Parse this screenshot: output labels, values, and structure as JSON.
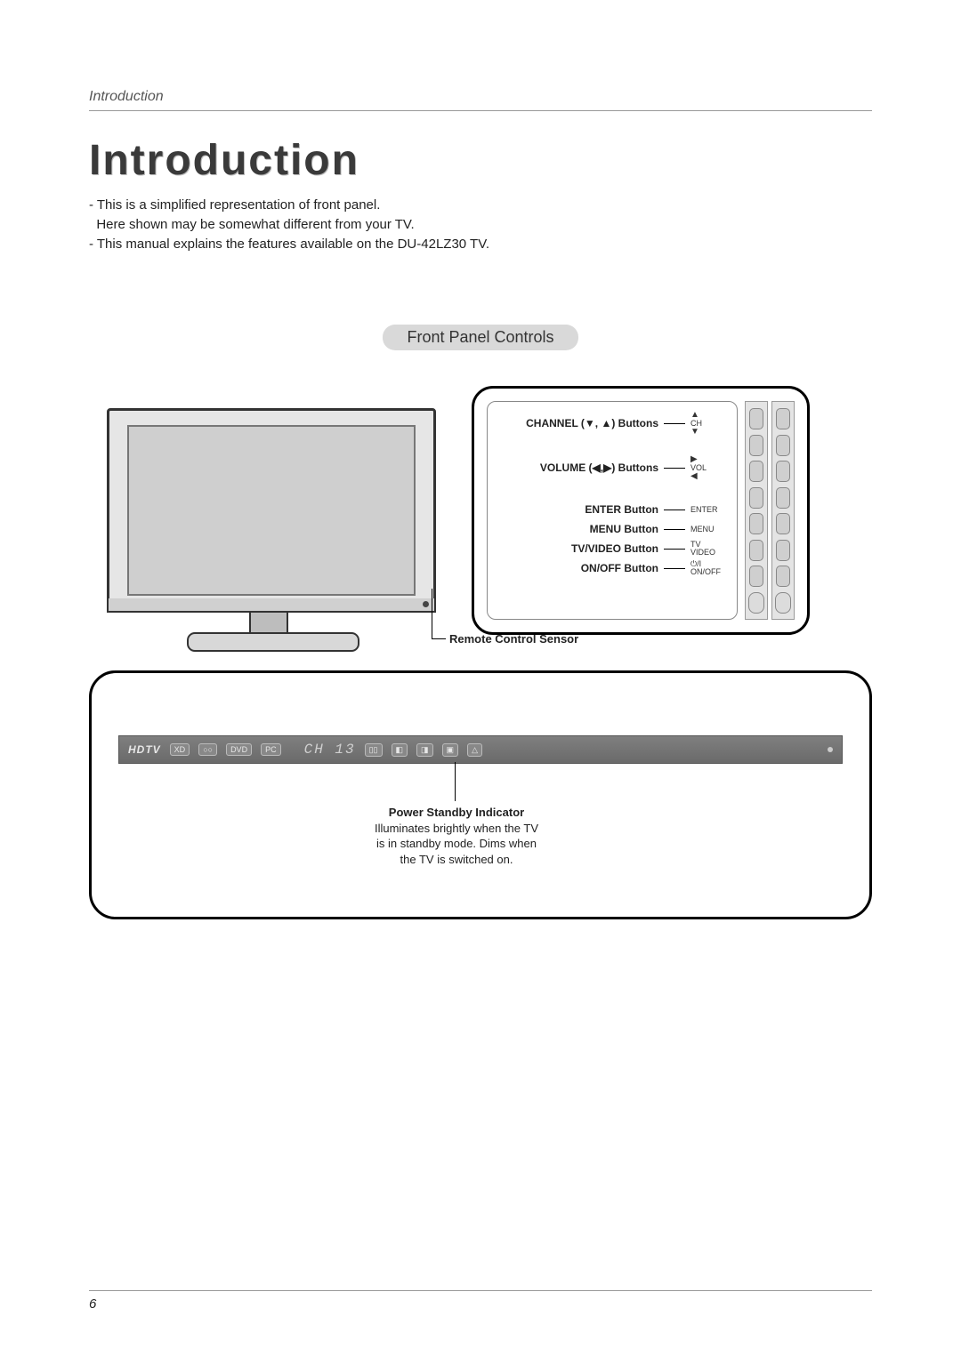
{
  "header": {
    "section": "Introduction"
  },
  "title": "Introduction",
  "intro": {
    "line1": "- This is a simplified representation of front panel.",
    "line2": "  Here shown may be somewhat different from your TV.",
    "line3": "- This manual explains the features available on the DU-42LZ30 TV."
  },
  "section_pill": "Front Panel Controls",
  "buttons": {
    "channel": {
      "label": "CHANNEL (▼, ▲) Buttons",
      "mark": "CH"
    },
    "volume": {
      "label": "VOLUME (◀,▶) Buttons",
      "mark": "VOL"
    },
    "enter": {
      "label": "ENTER Button",
      "mark": "ENTER"
    },
    "menu": {
      "label": "MENU Button",
      "mark": "MENU"
    },
    "tvvideo": {
      "label": "TV/VIDEO Button",
      "mark": "TV\nVIDEO"
    },
    "onoff": {
      "label": "ON/OFF Button",
      "mark": "⏻/I\nON/OFF"
    }
  },
  "sensor_label": "Remote Control Sensor",
  "lcd": {
    "hdtv": "HDTV",
    "segment": "CH  13",
    "badges": [
      "XD",
      "○○",
      "DVD",
      "PC"
    ]
  },
  "psi": {
    "title": "Power Standby Indicator",
    "line1": "Illuminates brightly when the TV",
    "line2": "is in standby mode. Dims when",
    "line3": "the TV is switched on."
  },
  "page_number": "6"
}
